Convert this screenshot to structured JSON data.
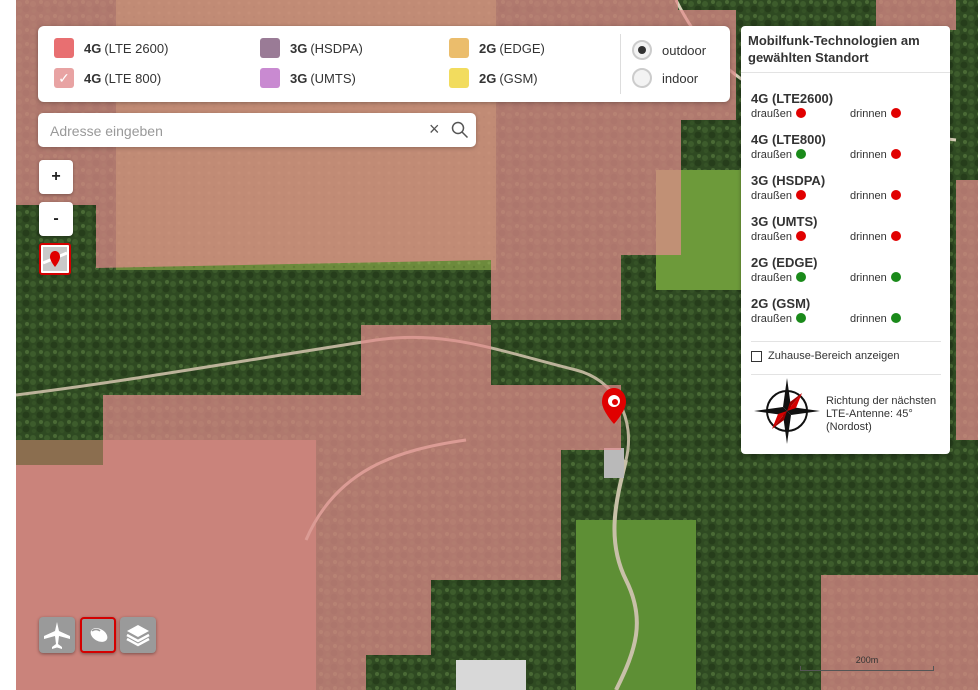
{
  "legend": {
    "items": [
      {
        "tech": "4G",
        "label": "(LTE 2600)",
        "color": "#e86f71",
        "checked": false
      },
      {
        "tech": "4G",
        "label": "(LTE 800)",
        "color": "#e8a3a3",
        "checked": true
      },
      {
        "tech": "3G",
        "label": "(HSDPA)",
        "color": "#9a7b96",
        "checked": false
      },
      {
        "tech": "3G",
        "label": "(UMTS)",
        "color": "#c98ad1",
        "checked": false
      },
      {
        "tech": "2G",
        "label": "(EDGE)",
        "color": "#ebbd6c",
        "checked": false
      },
      {
        "tech": "2G",
        "label": "(GSM)",
        "color": "#f2dc5e",
        "checked": false
      }
    ],
    "mode_outdoor": "outdoor",
    "mode_indoor": "indoor",
    "selected_mode": "outdoor"
  },
  "search": {
    "placeholder": "Adresse eingeben",
    "value": ""
  },
  "controls": {
    "zoom_in": "+",
    "zoom_out": "-"
  },
  "scale_label": "200m",
  "panel": {
    "title": "Mobilfunk-Technologien am gewählten Standort",
    "outside_label": "draußen",
    "inside_label": "drinnen",
    "technologies": [
      {
        "name": "4G (LTE2600)",
        "outdoor": "red",
        "indoor": "red"
      },
      {
        "name": "4G (LTE800)",
        "outdoor": "green",
        "indoor": "red"
      },
      {
        "name": "3G (HSDPA)",
        "outdoor": "red",
        "indoor": "red"
      },
      {
        "name": "3G (UMTS)",
        "outdoor": "red",
        "indoor": "red"
      },
      {
        "name": "2G (EDGE)",
        "outdoor": "green",
        "indoor": "green"
      },
      {
        "name": "2G (GSM)",
        "outdoor": "green",
        "indoor": "green"
      }
    ],
    "home_area": "Zuhause-Bereich anzeigen",
    "antenna_text": "Richtung der nächsten LTE-Antenne: 45° (Nordost)"
  },
  "colors": {
    "status_red": "#e10000",
    "status_green": "#1a8a1a",
    "accent": "#d40000"
  }
}
